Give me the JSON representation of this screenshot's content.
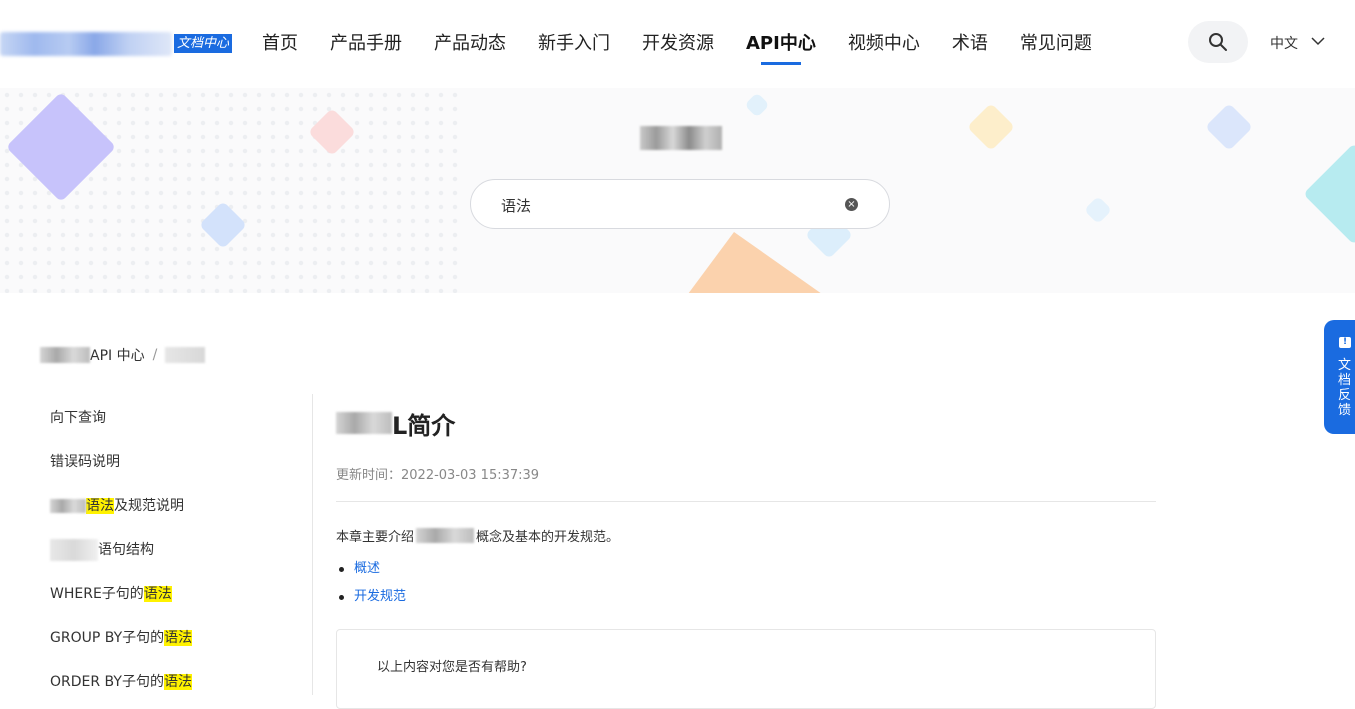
{
  "header": {
    "logo_badge": "文档中心",
    "nav": [
      "首页",
      "产品手册",
      "产品动态",
      "新手入门",
      "开发资源",
      "API中心",
      "视频中心",
      "术语",
      "常见问题"
    ],
    "active_nav": "API中心",
    "language": "中文"
  },
  "banner": {
    "search_value": "语法"
  },
  "breadcrumb": {
    "item_api": "API 中心",
    "separator": "/"
  },
  "sidebar": {
    "items": [
      {
        "pre": "向下查询",
        "hl": "",
        "post": ""
      },
      {
        "pre": "错误码说明",
        "hl": "",
        "post": ""
      },
      {
        "pre": "",
        "hl": "语法",
        "post": "及规范说明"
      },
      {
        "pre": "",
        "hl": "",
        "post": "语句结构"
      },
      {
        "pre": "WHERE子句的",
        "hl": "语法",
        "post": ""
      },
      {
        "pre": "GROUP BY子句的",
        "hl": "语法",
        "post": ""
      },
      {
        "pre": "ORDER BY子句的",
        "hl": "语法",
        "post": ""
      }
    ]
  },
  "article": {
    "title_suffix": "L简介",
    "updated": "更新时间：2022-03-03 15:37:39",
    "intro_pre": "本章主要介绍",
    "intro_post": "概念及基本的开发规范。",
    "links": [
      "概述",
      "开发规范"
    ],
    "feedback_question": "以上内容对您是否有帮助?"
  },
  "float_feedback": {
    "label": "文档反馈"
  },
  "colors": {
    "accent": "#1a6be0",
    "highlight": "#fff200"
  }
}
